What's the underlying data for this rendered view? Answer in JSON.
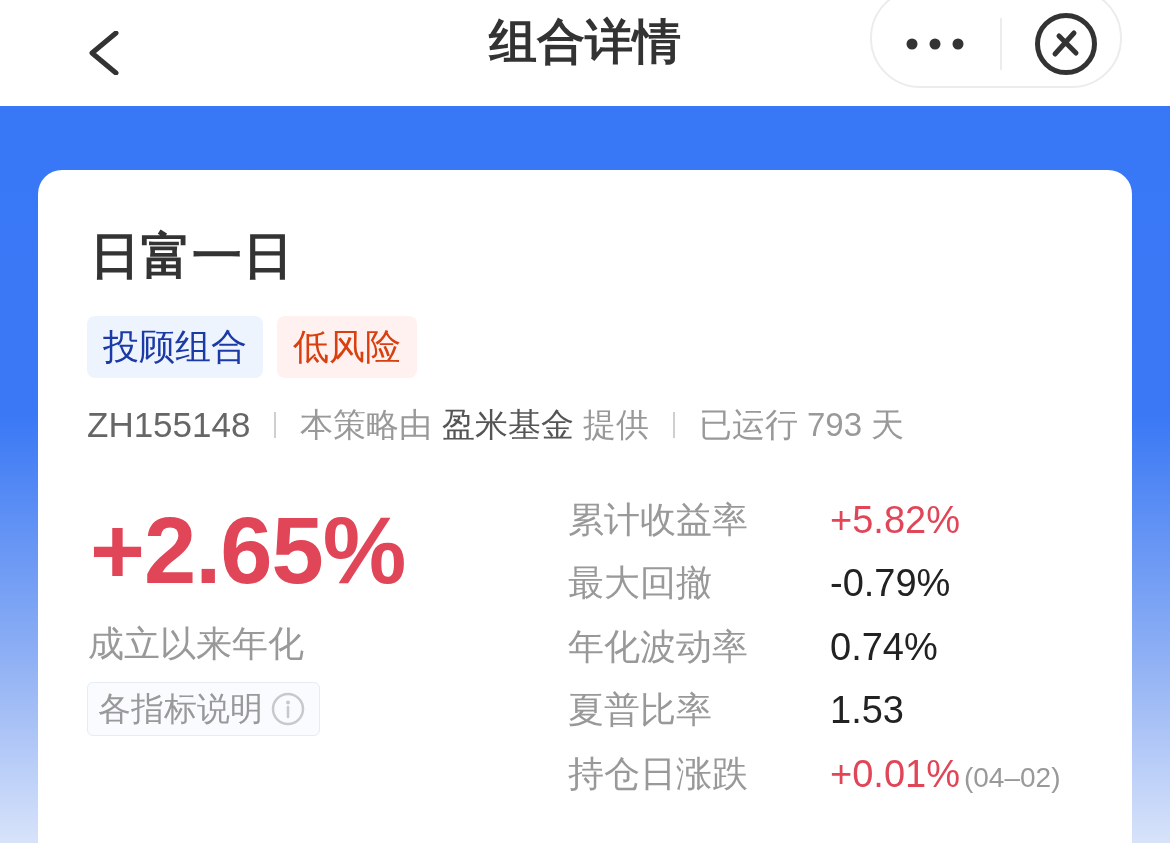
{
  "nav_bar": {
    "title": "组合详情"
  },
  "portfolio": {
    "name": "日富一日",
    "tags": [
      {
        "label": "投顾组合",
        "kind": "type"
      },
      {
        "label": "低风险",
        "kind": "risk"
      }
    ],
    "meta": {
      "code": "ZH155148",
      "provider_prefix": "本策略由",
      "provider": "盈米基金",
      "provider_suffix": "提供",
      "running": "已运行 793 天"
    }
  },
  "headline": {
    "value": "+2.65%",
    "caption": "成立以来年化",
    "help_button": "各指标说明"
  },
  "metrics": [
    {
      "label": "累计收益率",
      "value": "+5.82%",
      "color": "#e04658"
    },
    {
      "label": "最大回撤",
      "value": "-0.79%",
      "color": "#222222"
    },
    {
      "label": "年化波动率",
      "value": "0.74%",
      "color": "#222222"
    },
    {
      "label": "夏普比率",
      "value": "1.53",
      "color": "#222222"
    },
    {
      "label": "持仓日涨跌",
      "value": "+0.01%",
      "color": "#e04658",
      "note": "(04–02)"
    }
  ]
}
